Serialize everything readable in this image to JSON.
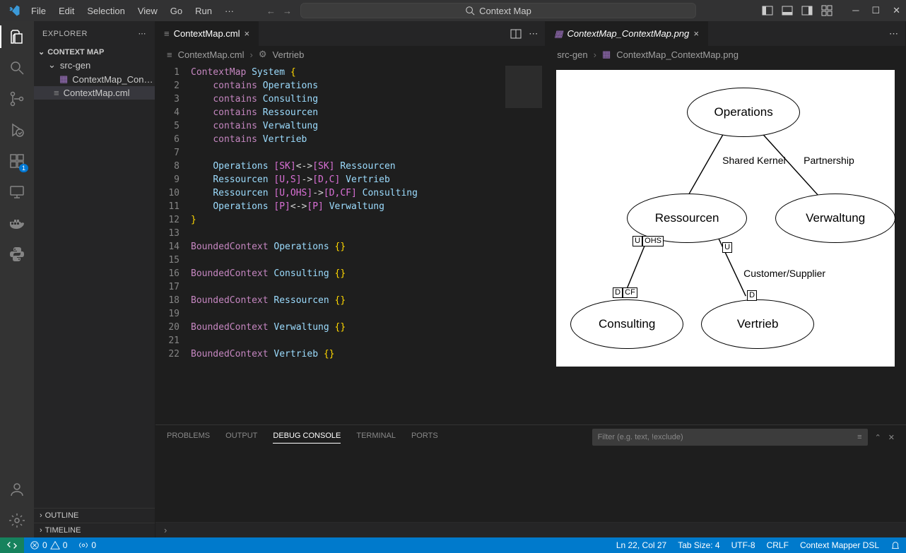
{
  "menu": [
    "File",
    "Edit",
    "Selection",
    "View",
    "Go",
    "Run",
    "···"
  ],
  "search_label": "Context Map",
  "explorer": {
    "title": "EXPLORER",
    "root": "CONTEXT MAP",
    "folder": "src-gen",
    "file_png": "ContextMap_Contex...",
    "file_cml": "ContextMap.cml",
    "outline": "OUTLINE",
    "timeline": "TIMELINE"
  },
  "tabs": {
    "left": "ContextMap.cml",
    "right": "ContextMap_ContextMap.png"
  },
  "breadcrumb_left": {
    "a": "ContextMap.cml",
    "b": "Vertrieb"
  },
  "breadcrumb_right": {
    "a": "src-gen",
    "b": "ContextMap_ContextMap.png"
  },
  "code_lines": [
    {
      "n": 1,
      "t": [
        [
          "kw",
          "ContextMap"
        ],
        [
          "sp",
          " "
        ],
        [
          "ident",
          "System"
        ],
        [
          "sp",
          " "
        ],
        [
          "brace",
          "{"
        ]
      ]
    },
    {
      "n": 2,
      "t": [
        [
          "ind",
          "    "
        ],
        [
          "kw",
          "contains"
        ],
        [
          "sp",
          " "
        ],
        [
          "ident",
          "Operations"
        ]
      ]
    },
    {
      "n": 3,
      "t": [
        [
          "ind",
          "    "
        ],
        [
          "kw",
          "contains"
        ],
        [
          "sp",
          " "
        ],
        [
          "ident",
          "Consulting"
        ]
      ]
    },
    {
      "n": 4,
      "t": [
        [
          "ind",
          "    "
        ],
        [
          "kw",
          "contains"
        ],
        [
          "sp",
          " "
        ],
        [
          "ident",
          "Ressourcen"
        ]
      ]
    },
    {
      "n": 5,
      "t": [
        [
          "ind",
          "    "
        ],
        [
          "kw",
          "contains"
        ],
        [
          "sp",
          " "
        ],
        [
          "ident",
          "Verwaltung"
        ]
      ]
    },
    {
      "n": 6,
      "t": [
        [
          "ind",
          "    "
        ],
        [
          "kw",
          "contains"
        ],
        [
          "sp",
          " "
        ],
        [
          "ident",
          "Vertrieb"
        ]
      ]
    },
    {
      "n": 7,
      "t": []
    },
    {
      "n": 8,
      "t": [
        [
          "ind",
          "    "
        ],
        [
          "ident",
          "Operations "
        ],
        [
          "bracket",
          "[SK]"
        ],
        [
          "arrow",
          "<->"
        ],
        [
          "bracket",
          "[SK]"
        ],
        [
          "sp",
          " "
        ],
        [
          "ident",
          "Ressourcen"
        ]
      ]
    },
    {
      "n": 9,
      "t": [
        [
          "ind",
          "    "
        ],
        [
          "ident",
          "Ressourcen "
        ],
        [
          "bracket",
          "[U,S]"
        ],
        [
          "arrow",
          "->"
        ],
        [
          "bracket",
          "[D,C]"
        ],
        [
          "sp",
          " "
        ],
        [
          "ident",
          "Vertrieb"
        ]
      ]
    },
    {
      "n": 10,
      "t": [
        [
          "ind",
          "    "
        ],
        [
          "ident",
          "Ressourcen "
        ],
        [
          "bracket",
          "[U,OHS]"
        ],
        [
          "arrow",
          "->"
        ],
        [
          "bracket",
          "[D,CF]"
        ],
        [
          "sp",
          " "
        ],
        [
          "ident",
          "Consulting"
        ]
      ]
    },
    {
      "n": 11,
      "t": [
        [
          "ind",
          "    "
        ],
        [
          "ident",
          "Operations "
        ],
        [
          "bracket",
          "[P]"
        ],
        [
          "arrow",
          "<->"
        ],
        [
          "bracket",
          "[P]"
        ],
        [
          "sp",
          " "
        ],
        [
          "ident",
          "Verwaltung"
        ]
      ]
    },
    {
      "n": 12,
      "t": [
        [
          "brace",
          "}"
        ]
      ]
    },
    {
      "n": 13,
      "t": []
    },
    {
      "n": 14,
      "t": [
        [
          "kw",
          "BoundedContext"
        ],
        [
          "sp",
          " "
        ],
        [
          "ident",
          "Operations"
        ],
        [
          "sp",
          " "
        ],
        [
          "brace",
          "{}"
        ]
      ]
    },
    {
      "n": 15,
      "t": []
    },
    {
      "n": 16,
      "t": [
        [
          "kw",
          "BoundedContext"
        ],
        [
          "sp",
          " "
        ],
        [
          "ident",
          "Consulting"
        ],
        [
          "sp",
          " "
        ],
        [
          "brace",
          "{}"
        ]
      ]
    },
    {
      "n": 17,
      "t": []
    },
    {
      "n": 18,
      "t": [
        [
          "kw",
          "BoundedContext"
        ],
        [
          "sp",
          " "
        ],
        [
          "ident",
          "Ressourcen"
        ],
        [
          "sp",
          " "
        ],
        [
          "brace",
          "{}"
        ]
      ]
    },
    {
      "n": 19,
      "t": []
    },
    {
      "n": 20,
      "t": [
        [
          "kw",
          "BoundedContext"
        ],
        [
          "sp",
          " "
        ],
        [
          "ident",
          "Verwaltung"
        ],
        [
          "sp",
          " "
        ],
        [
          "brace",
          "{}"
        ]
      ]
    },
    {
      "n": 21,
      "t": []
    },
    {
      "n": 22,
      "t": [
        [
          "kw",
          "BoundedContext"
        ],
        [
          "sp",
          " "
        ],
        [
          "ident",
          "Vertrieb"
        ],
        [
          "sp",
          " "
        ],
        [
          "brace",
          "{}"
        ]
      ]
    }
  ],
  "diagram": {
    "nodes": {
      "operations": "Operations",
      "ressourcen": "Ressourcen",
      "verwaltung": "Verwaltung",
      "consulting": "Consulting",
      "vertrieb": "Vertrieb"
    },
    "edge_labels": {
      "shared": "Shared Kernel",
      "partnership": "Partnership",
      "custsup": "Customer/Supplier"
    },
    "role_labels": {
      "u": "U",
      "ohs": "OHS",
      "d": "D",
      "cf": "CF"
    }
  },
  "panel": {
    "tabs": {
      "problems": "PROBLEMS",
      "output": "OUTPUT",
      "debug": "DEBUG CONSOLE",
      "terminal": "TERMINAL",
      "ports": "PORTS"
    },
    "filter_placeholder": "Filter (e.g. text, !exclude)"
  },
  "status": {
    "errors": "0",
    "warnings": "0",
    "ports": "0",
    "lncol": "Ln 22, Col 27",
    "tabsize": "Tab Size: 4",
    "encoding": "UTF-8",
    "eol": "CRLF",
    "lang": "Context Mapper DSL"
  }
}
